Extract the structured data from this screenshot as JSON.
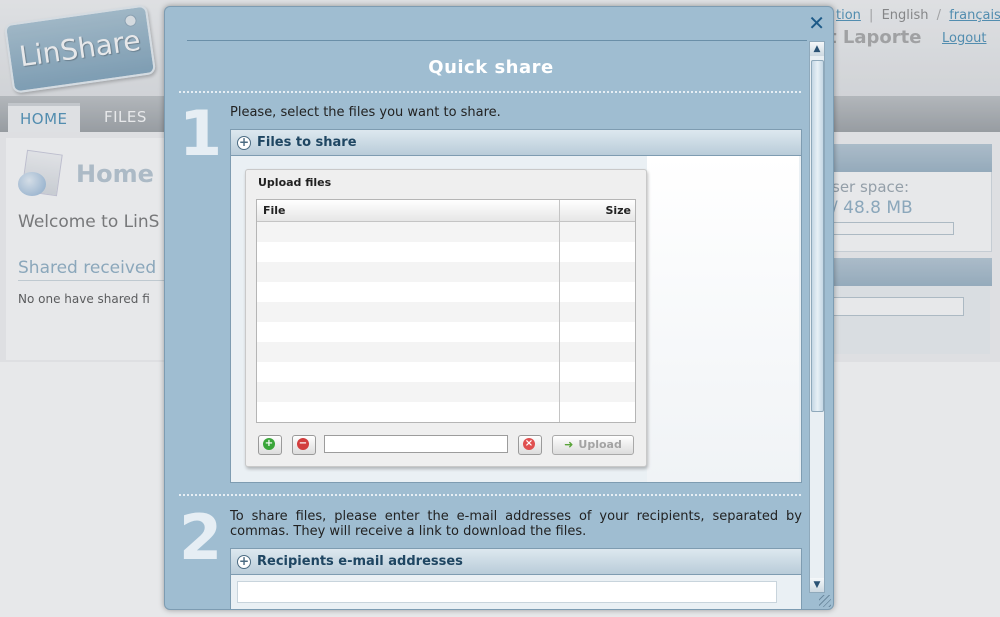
{
  "app": {
    "logo_text": "LinShare",
    "lang_links": {
      "left_partial": "tion",
      "english": "English",
      "separator": "/",
      "pipe": "|",
      "french": "français"
    },
    "user_partial": "t Laporte",
    "logout": "Logout"
  },
  "nav": {
    "tabs": [
      {
        "label": "HOME"
      },
      {
        "label": "FILES"
      }
    ]
  },
  "home": {
    "title": "Home",
    "welcome": "Welcome to LinS",
    "shared_received": "Shared received",
    "no_shared": "No one have shared fi"
  },
  "sidebar_right": {
    "user_space_label": "ser space:",
    "user_space_value": "/ 48.8 MB"
  },
  "modal": {
    "title": "Quick share",
    "close_symbol": "✕",
    "step1": {
      "number": "1",
      "instruction": "Please, select the files you want to share.",
      "section_title": "Files to share",
      "upload": {
        "title": "Upload files",
        "columns": {
          "file": "File",
          "size": "Size"
        },
        "upload_button": "Upload"
      }
    },
    "step2": {
      "number": "2",
      "instruction": "To share files, please enter the e-mail addresses of your recipients, separated by commas. They will receive a link to download the files.",
      "section_title": "Recipients e-mail addresses"
    }
  },
  "icons": {
    "plus": "+",
    "add": "+",
    "remove": "−",
    "clear": "×",
    "upload_arrow": "➜",
    "scroll_up": "▲",
    "scroll_down": "▼"
  },
  "colors": {
    "modal_bg": "#9fbdd1",
    "link": "#4a90b8",
    "header_text": "#1f4662"
  }
}
